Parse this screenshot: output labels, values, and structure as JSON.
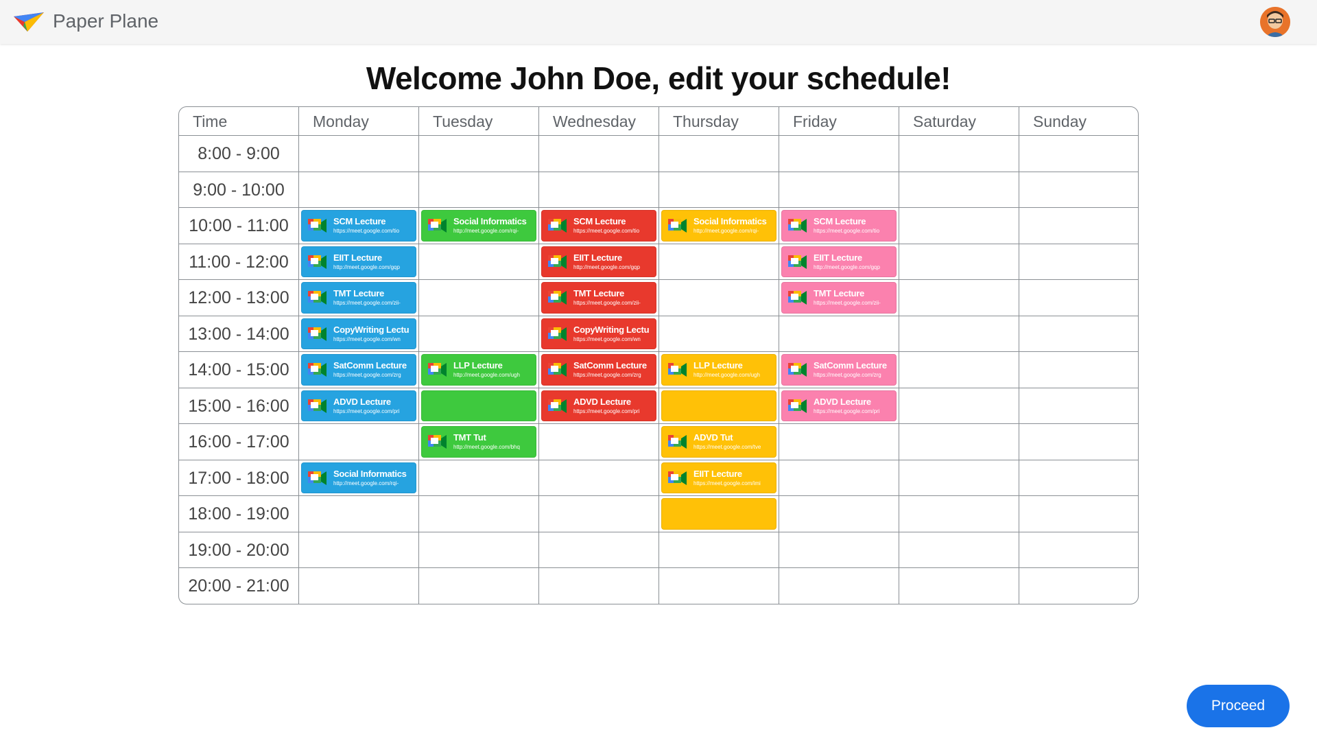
{
  "app": {
    "name": "Paper Plane"
  },
  "page": {
    "title": "Welcome John Doe, edit your schedule!"
  },
  "schedule": {
    "headers": [
      "Time",
      "Monday",
      "Tuesday",
      "Wednesday",
      "Thursday",
      "Friday",
      "Saturday",
      "Sunday"
    ],
    "time_slots": [
      "8:00 - 9:00",
      "9:00 - 10:00",
      "10:00 - 11:00",
      "11:00 - 12:00",
      "12:00 - 13:00",
      "13:00 - 14:00",
      "14:00 - 15:00",
      "15:00 - 16:00",
      "16:00 - 17:00",
      "17:00 - 18:00",
      "18:00 - 19:00",
      "19:00 - 20:00",
      "20:00 - 21:00"
    ],
    "colors": {
      "blue": "#26a3e0",
      "green": "#3ec93e",
      "red": "#e8392d",
      "yellow": "#ffc107",
      "pink": "#fb81ae"
    },
    "events": [
      {
        "day": 0,
        "slot": 2,
        "color": "blue",
        "title": "SCM Lecture",
        "link": "https://meet.google.com/tio"
      },
      {
        "day": 0,
        "slot": 3,
        "color": "blue",
        "title": "EIIT Lecture",
        "link": "http://meet.google.com/gqp"
      },
      {
        "day": 0,
        "slot": 4,
        "color": "blue",
        "title": "TMT Lecture",
        "link": "https://meet.google.com/zii-"
      },
      {
        "day": 0,
        "slot": 5,
        "color": "blue",
        "title": "CopyWriting Lectu",
        "link": "https://meet.google.com/wn"
      },
      {
        "day": 0,
        "slot": 6,
        "color": "blue",
        "title": "SatComm Lecture",
        "link": "https://meet.google.com/zrg"
      },
      {
        "day": 0,
        "slot": 7,
        "color": "blue",
        "title": "ADVD Lecture",
        "link": "https://meet.google.com/pri"
      },
      {
        "day": 0,
        "slot": 9,
        "color": "blue",
        "title": "Social Informatics",
        "link": "http://meet.google.com/rqi-"
      },
      {
        "day": 1,
        "slot": 2,
        "color": "green",
        "title": "Social Informatics",
        "link": "http://meet.google.com/rqi-"
      },
      {
        "day": 1,
        "slot": 6,
        "color": "green",
        "title": "LLP Lecture",
        "link": "http://meet.google.com/ugh"
      },
      {
        "day": 1,
        "slot": 7,
        "color": "green",
        "title": "",
        "link": ""
      },
      {
        "day": 1,
        "slot": 8,
        "color": "green",
        "title": "TMT Tut",
        "link": "http://meet.google.com/bhq"
      },
      {
        "day": 2,
        "slot": 2,
        "color": "red",
        "title": "SCM Lecture",
        "link": "https://meet.google.com/tio"
      },
      {
        "day": 2,
        "slot": 3,
        "color": "red",
        "title": "EIIT Lecture",
        "link": "http://meet.google.com/gqp"
      },
      {
        "day": 2,
        "slot": 4,
        "color": "red",
        "title": "TMT Lecture",
        "link": "https://meet.google.com/zii-"
      },
      {
        "day": 2,
        "slot": 5,
        "color": "red",
        "title": "CopyWriting Lectu",
        "link": "https://meet.google.com/wn"
      },
      {
        "day": 2,
        "slot": 6,
        "color": "red",
        "title": "SatComm Lecture",
        "link": "https://meet.google.com/zrg"
      },
      {
        "day": 2,
        "slot": 7,
        "color": "red",
        "title": "ADVD Lecture",
        "link": "https://meet.google.com/pri"
      },
      {
        "day": 3,
        "slot": 2,
        "color": "yellow",
        "title": "Social Informatics",
        "link": "http://meet.google.com/rqi-"
      },
      {
        "day": 3,
        "slot": 6,
        "color": "yellow",
        "title": "LLP Lecture",
        "link": "http://meet.google.com/ugh"
      },
      {
        "day": 3,
        "slot": 7,
        "color": "yellow",
        "title": "",
        "link": ""
      },
      {
        "day": 3,
        "slot": 8,
        "color": "yellow",
        "title": "ADVD Tut",
        "link": "https://meet.google.com/tve"
      },
      {
        "day": 3,
        "slot": 9,
        "color": "yellow",
        "title": "EIIT Lecture",
        "link": "https://meet.google.com/imi"
      },
      {
        "day": 3,
        "slot": 10,
        "color": "yellow",
        "title": "",
        "link": ""
      },
      {
        "day": 4,
        "slot": 2,
        "color": "pink",
        "title": "SCM Lecture",
        "link": "https://meet.google.com/tio"
      },
      {
        "day": 4,
        "slot": 3,
        "color": "pink",
        "title": "EIIT Lecture",
        "link": "http://meet.google.com/gqp"
      },
      {
        "day": 4,
        "slot": 4,
        "color": "pink",
        "title": "TMT Lecture",
        "link": "https://meet.google.com/zii-"
      },
      {
        "day": 4,
        "slot": 6,
        "color": "pink",
        "title": "SatComm Lecture",
        "link": "https://meet.google.com/zrg"
      },
      {
        "day": 4,
        "slot": 7,
        "color": "pink",
        "title": "ADVD Lecture",
        "link": "https://meet.google.com/pri"
      }
    ]
  },
  "icons": {
    "logo": "paper-plane-logo-icon",
    "avatar": "user-avatar",
    "event": "google-meet-icon"
  },
  "actions": {
    "proceed_label": "Proceed"
  }
}
